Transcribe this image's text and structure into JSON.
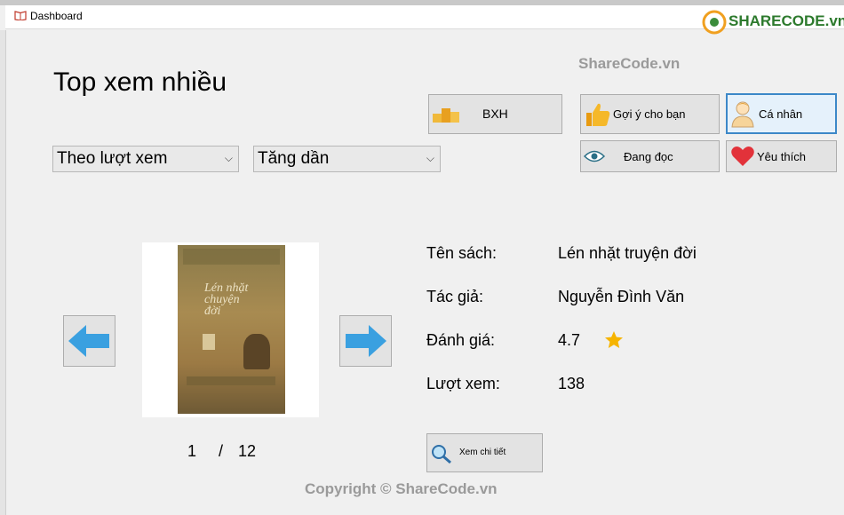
{
  "window": {
    "title": "Dashboard"
  },
  "header": {
    "title": "Top xem nhiều"
  },
  "filters": {
    "sort_by": "Theo lượt xem",
    "order": "Tăng dần"
  },
  "nav": {
    "bxh": "BXH",
    "recommend": "Gợi ý cho bạn",
    "profile": "Cá nhân",
    "reading": "Đang đọc",
    "favorite": "Yêu thích"
  },
  "book": {
    "cover_title": "Lén nhặt chuyện đời",
    "name_label": "Tên sách:",
    "name": "Lén nhặt truyện đời",
    "author_label": "Tác giả:",
    "author": "Nguyễn Đình Văn",
    "rating_label": "Đánh giá:",
    "rating": "4.7",
    "views_label": "Lượt xem:",
    "views": "138"
  },
  "pagination": {
    "current": "1",
    "separator": "/",
    "total": "12"
  },
  "details_button": "Xem chi tiết",
  "watermarks": {
    "top": "ShareCode.vn",
    "bottom": "Copyright © ShareCode.vn",
    "logo": "SHARECODE.vn"
  },
  "colors": {
    "accent_blue": "#3aa0e0",
    "heart": "#e2323a",
    "star": "#f6b400"
  }
}
